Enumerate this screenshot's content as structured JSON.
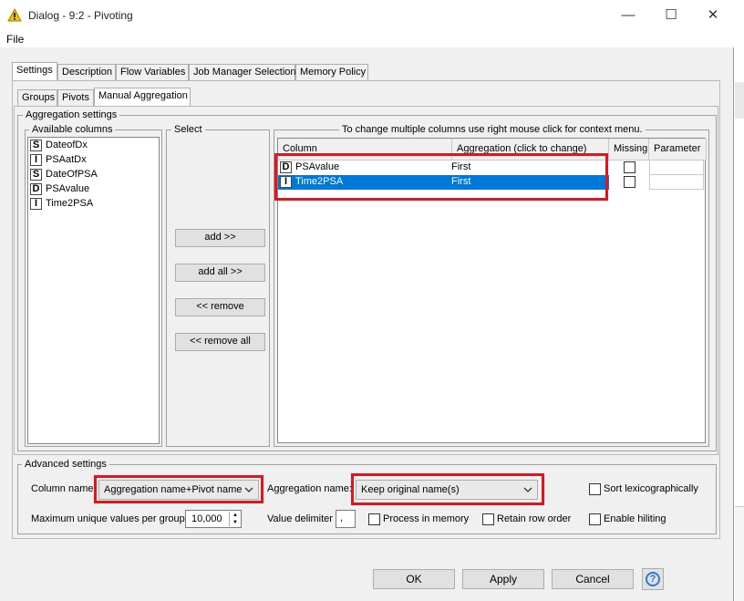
{
  "window": {
    "title": "Dialog - 9:2 - Pivoting",
    "menu_file": "File",
    "minimize": "—",
    "maximize": "☐",
    "close": "✕"
  },
  "main_tabs": [
    "Settings",
    "Description",
    "Flow Variables",
    "Job Manager Selection",
    "Memory Policy"
  ],
  "sub_tabs": [
    "Groups",
    "Pivots",
    "Manual Aggregation"
  ],
  "aggregation_settings": {
    "legend": "Aggregation settings",
    "available_legend": "Available columns",
    "available_columns": [
      {
        "type": "S",
        "name": "DateofDx"
      },
      {
        "type": "I",
        "name": "PSAatDx"
      },
      {
        "type": "S",
        "name": "DateOfPSA"
      },
      {
        "type": "D",
        "name": "PSAvalue"
      },
      {
        "type": "I",
        "name": "Time2PSA"
      }
    ],
    "select_legend": "Select",
    "buttons": {
      "add": "add >>",
      "add_all": "add all >>",
      "remove": "<< remove",
      "remove_all": "<< remove all"
    },
    "table_legend": "To change multiple columns use right mouse click for context menu.",
    "table_headers": {
      "column": "Column",
      "aggregation": "Aggregation (click to change)",
      "missing": "Missing",
      "parameter": "Parameter"
    },
    "table_rows": [
      {
        "type": "D",
        "column": "PSAvalue",
        "aggregation": "First",
        "selected": false
      },
      {
        "type": "I",
        "column": "Time2PSA",
        "aggregation": "First",
        "selected": true
      }
    ]
  },
  "advanced_settings": {
    "legend": "Advanced settings",
    "column_name_label": "Column name:",
    "column_name_value": "Aggregation name+Pivot name",
    "aggregation_name_label": "Aggregation name:",
    "aggregation_name_value": "Keep original name(s)",
    "sort_lex_label": "Sort lexicographically",
    "max_unique_label": "Maximum unique values per group",
    "max_unique_value": "10,000",
    "value_delimiter_label": "Value delimiter",
    "value_delimiter_value": ",",
    "process_in_memory_label": "Process in memory",
    "retain_row_order_label": "Retain row order",
    "enable_hiliting_label": "Enable hiliting"
  },
  "footer": {
    "ok": "OK",
    "apply": "Apply",
    "cancel": "Cancel",
    "help": "?"
  },
  "colors": {
    "selection": "#0078d7",
    "highlight": "#e0161f",
    "title_icon": "#f2c200"
  }
}
